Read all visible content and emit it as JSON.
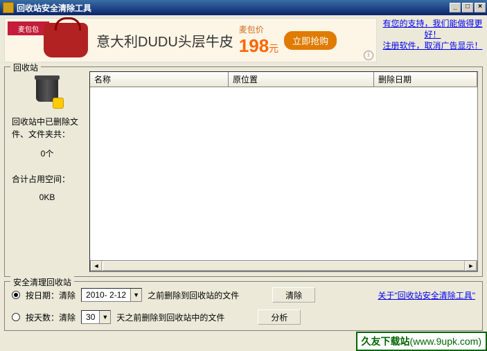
{
  "window": {
    "title": "回收站安全清除工具",
    "min": "_",
    "max": "□",
    "close": "×"
  },
  "ad": {
    "logo": "麦包包",
    "text": "意大利DUDU头层牛皮",
    "price_label": "麦包价",
    "price_num": "198",
    "price_unit": "元",
    "btn": "立即抢购",
    "link1": "有您的支持，我们能做得更好！",
    "link2": "注册软件，取消广告显示！"
  },
  "recycle": {
    "legend": "回收站",
    "deleted_label": "回收站中已删除文件、文件夹共：",
    "deleted_count": "0个",
    "space_label": "合计占用空间：",
    "space_value": "0KB",
    "columns": {
      "name": "名称",
      "location": "原位置",
      "date": "删除日期"
    }
  },
  "clean": {
    "legend": "安全清理回收站",
    "by_date_label": "按日期：清除",
    "date_value": "2010- 2-12",
    "by_date_suffix": "之前删除到回收站的文件",
    "clear_btn": "清除",
    "by_days_label": "按天数：清除",
    "days_value": "30",
    "by_days_suffix": "天之前删除到回收站中的文件",
    "analyze_btn": "分析",
    "about_link": "关于\"回收站安全清除工具\""
  },
  "watermark": {
    "site": "久友下载站",
    "url": "(www.9upk.com)"
  }
}
